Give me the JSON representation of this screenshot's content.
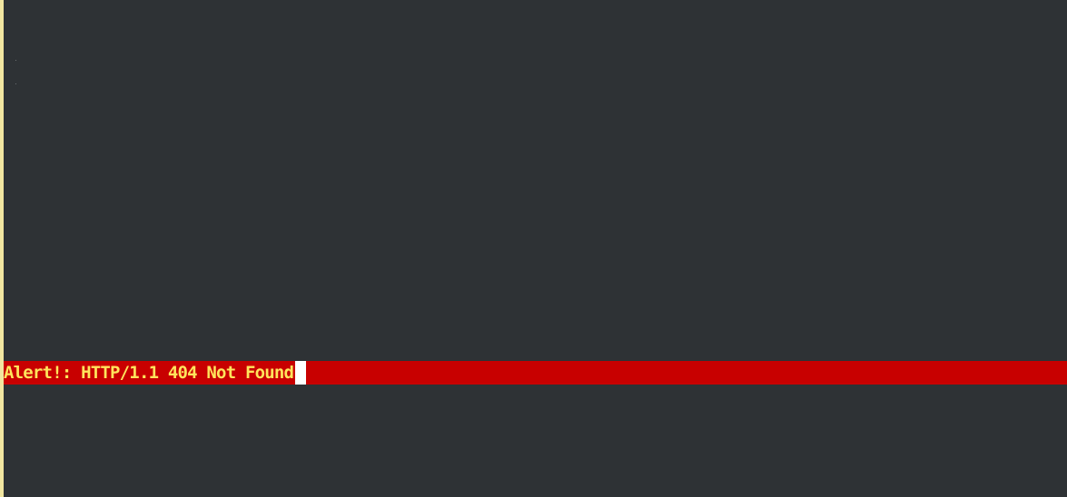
{
  "terminal": {
    "alert": {
      "message": "Alert!: HTTP/1.1 404 Not Found",
      "background_color": "#c80000",
      "text_color": "#ffe45c"
    },
    "background_color": "#2e3235",
    "cursor_color": "#ffffff"
  }
}
